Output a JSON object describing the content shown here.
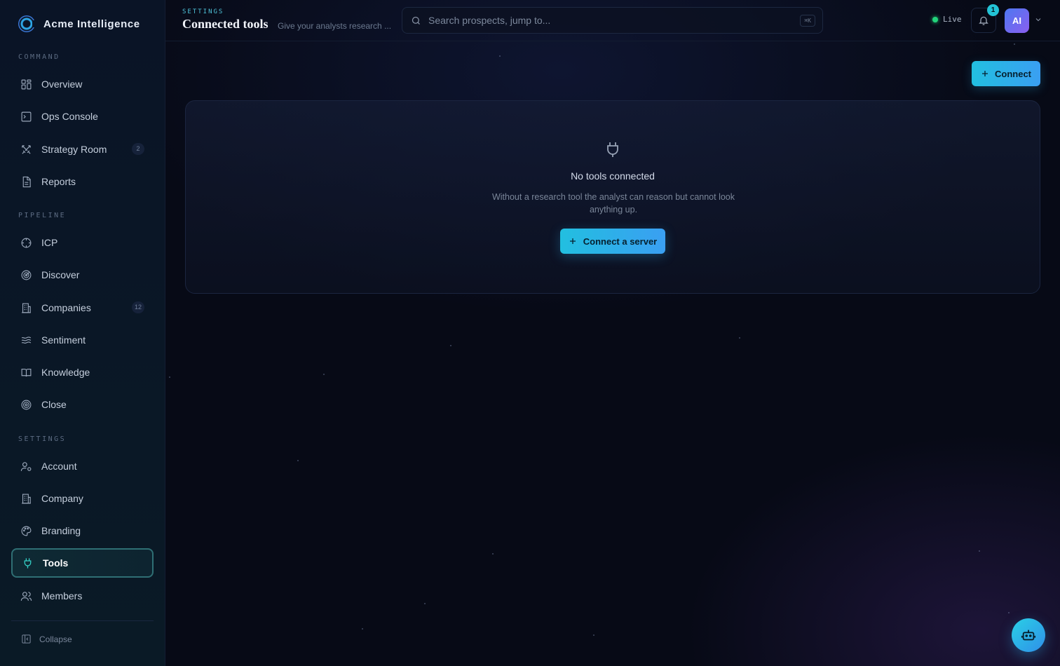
{
  "brand": {
    "name": "Acme Intelligence"
  },
  "sidebar": {
    "sections": [
      {
        "label": "COMMAND",
        "items": [
          {
            "label": "Overview",
            "icon": "grid-icon",
            "badge": ""
          },
          {
            "label": "Ops Console",
            "icon": "terminal-icon",
            "badge": ""
          },
          {
            "label": "Strategy Room",
            "icon": "swords-icon",
            "badge": "2"
          },
          {
            "label": "Reports",
            "icon": "document-icon",
            "badge": ""
          }
        ]
      },
      {
        "label": "PIPELINE",
        "items": [
          {
            "label": "ICP",
            "icon": "crosshair-icon",
            "badge": ""
          },
          {
            "label": "Discover",
            "icon": "radar-icon",
            "badge": ""
          },
          {
            "label": "Companies",
            "icon": "building-icon",
            "badge": "12"
          },
          {
            "label": "Sentiment",
            "icon": "waves-icon",
            "badge": ""
          },
          {
            "label": "Knowledge",
            "icon": "book-icon",
            "badge": ""
          },
          {
            "label": "Close",
            "icon": "target-icon",
            "badge": ""
          }
        ]
      },
      {
        "label": "SETTINGS",
        "items": [
          {
            "label": "Account",
            "icon": "user-cog-icon",
            "badge": ""
          },
          {
            "label": "Company",
            "icon": "building-icon",
            "badge": ""
          },
          {
            "label": "Branding",
            "icon": "palette-icon",
            "badge": ""
          },
          {
            "label": "Tools",
            "icon": "plug-icon",
            "badge": "",
            "active": true
          },
          {
            "label": "Members",
            "icon": "users-icon",
            "badge": ""
          }
        ]
      }
    ],
    "collapse_label": "Collapse"
  },
  "header": {
    "eyebrow": "SETTINGS",
    "title": "Connected tools",
    "subtitle": "Give your analysts research ...",
    "search_placeholder": "Search prospects, jump to...",
    "search_shortcut": "⌘K",
    "live_label": "Live",
    "notification_count": "1",
    "avatar_initials": "AI"
  },
  "main": {
    "connect_label": "Connect",
    "empty_state": {
      "title": "No tools connected",
      "text": "Without a research tool the analyst can reason but cannot look anything up.",
      "button_label": "Connect a server"
    }
  },
  "colors": {
    "accent": "#22bfe0",
    "accent_2": "#3a9ff2",
    "live": "#22d37b",
    "background": "#070a16",
    "sidebar": "#0a1426"
  }
}
